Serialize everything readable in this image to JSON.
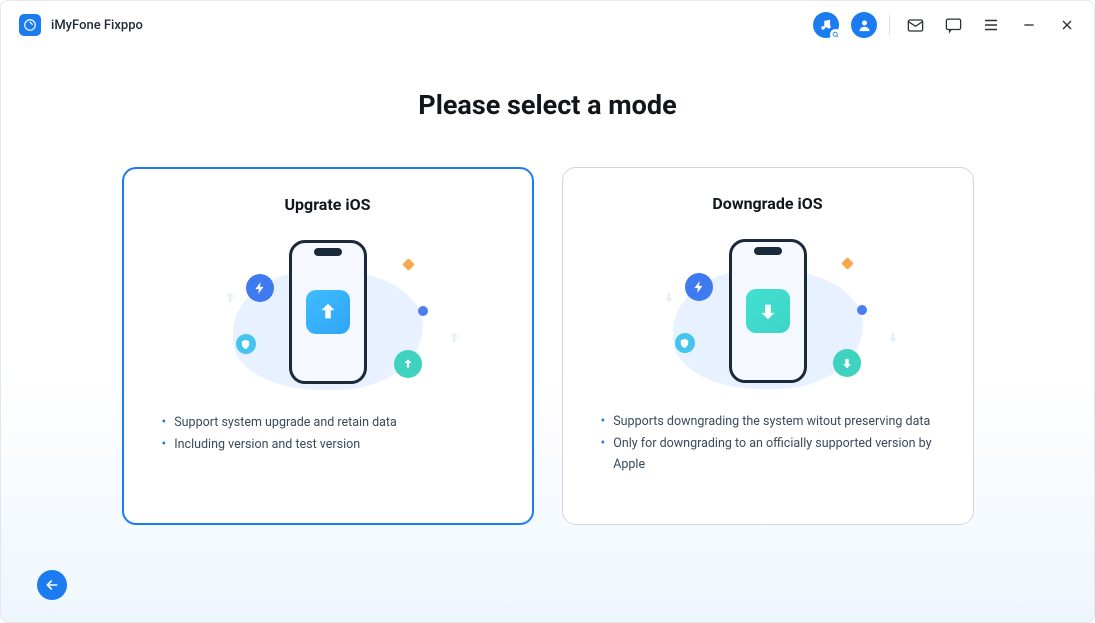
{
  "app": {
    "title": "iMyFone Fixppo"
  },
  "page": {
    "title": "Please select a mode"
  },
  "cards": {
    "upgrade": {
      "title": "Upgrate iOS",
      "bullet1": "Support system upgrade and retain data",
      "bullet2": "Including version and test version"
    },
    "downgrade": {
      "title": "Downgrade iOS",
      "bullet1": "Supports downgrading the system witout preserving data",
      "bullet2": "Only for downgrading to an officially supported version by Apple"
    }
  }
}
